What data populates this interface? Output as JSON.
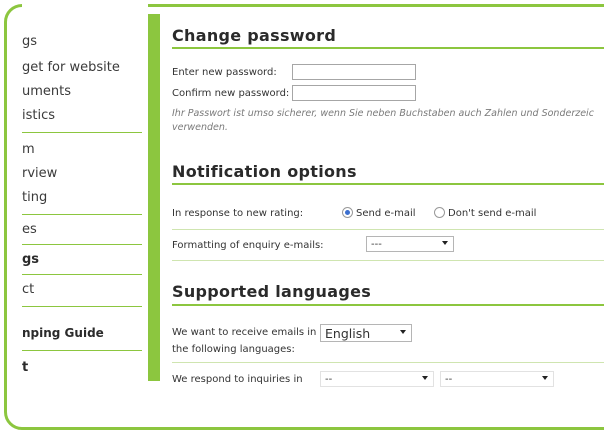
{
  "sidebar": {
    "items": [
      {
        "label": "gs"
      },
      {
        "label": "get for website"
      },
      {
        "label": "uments"
      },
      {
        "label": "istics"
      },
      {
        "label": "m"
      },
      {
        "label": "rview"
      },
      {
        "label": "ting"
      },
      {
        "label": "es"
      },
      {
        "label": "gs"
      },
      {
        "label": "ct"
      },
      {
        "label": "nping Guide"
      },
      {
        "label": "t"
      }
    ]
  },
  "password": {
    "title": "Change password",
    "new_label": "Enter new password:",
    "confirm_label": "Confirm new password:",
    "note_line1": "Ihr Passwort ist umso sicherer, wenn Sie neben Buchstaben auch Zahlen und Sonderzeic",
    "note_line2": "verwenden."
  },
  "notifications": {
    "title": "Notification options",
    "rating_label": "In response to new rating:",
    "send_email": "Send e-mail",
    "dont_send": "Don't send e-mail",
    "format_label": "Formatting of enquiry e-mails:",
    "format_value": "---"
  },
  "languages": {
    "title": "Supported languages",
    "receive_label_1": "We want to receive emails in",
    "receive_label_2": "the following languages:",
    "receive_value": "English",
    "respond_label": "We respond to inquiries in",
    "respond_value_1": "--",
    "respond_value_2": "--"
  }
}
